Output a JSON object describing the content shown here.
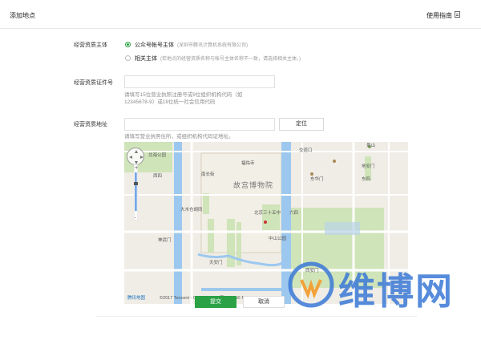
{
  "header": {
    "title": "添加地点",
    "guide": "使用指南"
  },
  "form": {
    "subject_label": "经营资质主体",
    "option1": {
      "label": "公众号帐号主体",
      "hint": "(深圳市腾讯计算机系统有限公司)"
    },
    "option2": {
      "label": "相关主体",
      "hint": "(若地点的经营资质名称与帐号主体名称不一致，请选择相关主体。)"
    },
    "cert_label": "经营资质证件号",
    "cert_hint_line1": "请填写15位营业执照注册号或9位组织机构代码（如",
    "cert_hint_line2": "12345678-9）或18位统一社会信用代码",
    "addr_label": "经营资质地址",
    "locate_button": "定位",
    "addr_hint": "请填写营业执照住所，或组织机构代码证地址。"
  },
  "map": {
    "title": "故宫博物院",
    "places": {
      "p1": "景山",
      "p2": "交道口",
      "p3": "北海公园",
      "p4": "福佑寺",
      "p5": "南长街",
      "p6": "东华门",
      "p7": "地安门",
      "p8": "东四",
      "p9": "西四",
      "p10": "大木仓胡同",
      "p11": "北京三十五中",
      "p12": "六四",
      "p13": "中山公园",
      "p14": "天安门",
      "p15": "神武门",
      "p16": "西安门"
    },
    "logo": "腾讯地图",
    "copyright": "©2017 Tencent - GS(2016)930号 - Data© NavInfo"
  },
  "buttons": {
    "submit": "提交",
    "cancel": "取消"
  },
  "watermark": "维博网",
  "colors": {
    "accent": "#2ba245",
    "watermark": "#3a78d6",
    "water": "#9cc8ef",
    "park": "#cfe4b9"
  }
}
